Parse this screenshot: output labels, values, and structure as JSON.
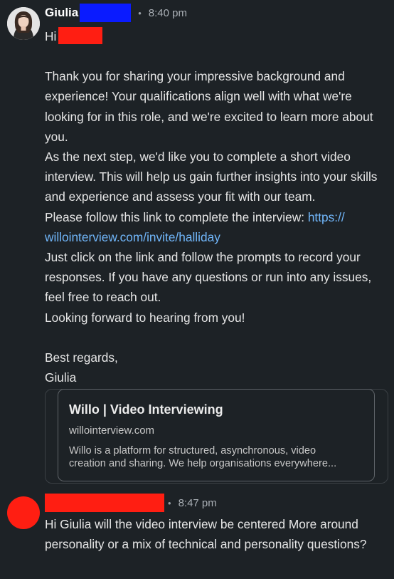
{
  "messages": [
    {
      "sender": "Giulia",
      "time": "8:40 pm",
      "greeting": "Hi",
      "paragraphs": [
        "Thank you for sharing your impressive background and experience! Your qualifications align well with what we're looking for in this role, and we're excited to learn more about you.",
        "As the next step, we'd like you to complete a short video interview. This will help us gain further insights into your skills and experience and assess your fit with our team.",
        "Please follow this link to complete the interview: ",
        "Just click on the link and follow the prompts to record your responses. If you have any questions or run into any issues, feel free to reach out.",
        "Looking forward to hearing from you!"
      ],
      "link_line_1": "https://",
      "link_line_2": "willointerview.com/invite/halliday",
      "signoff": "Best regards,",
      "signature": "Giulia",
      "preview_card": {
        "title": "Willo | Video Interviewing",
        "domain": "willointerview.com",
        "description_line_1": "Willo is a platform for structured, asynchronous, video",
        "description_line_2": "creation and sharing. We help organisations everywhere..."
      }
    },
    {
      "sender": "",
      "time": "8:47 pm",
      "text": "Hi Giulia will the video interview be centered More around personality or a mix of technical and personality questions?"
    }
  ],
  "colors": {
    "background": "#1d2226",
    "link": "#71b7fb",
    "redact_blue": "#0a1bff",
    "redact_red": "#ff1e12"
  }
}
